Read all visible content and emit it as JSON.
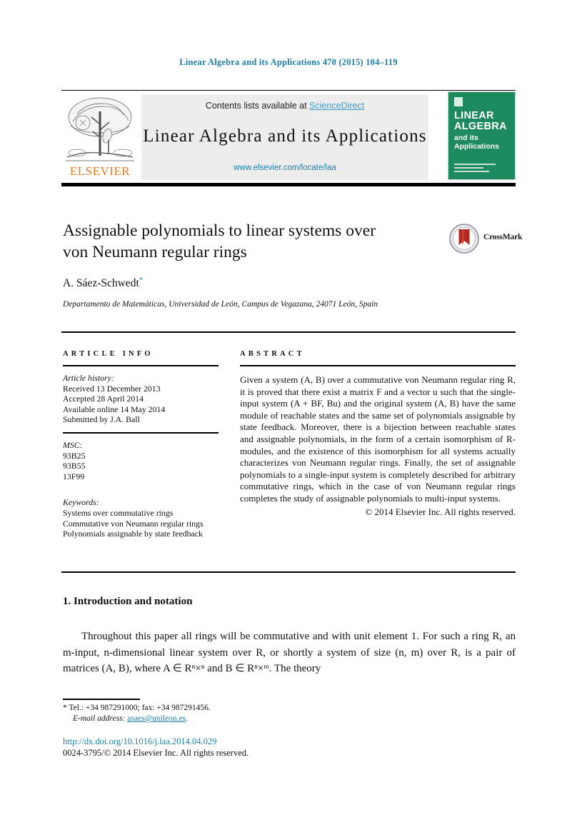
{
  "running_head": "Linear Algebra and its Applications 470 (2015) 104–119",
  "masthead": {
    "contents_prefix": "Contents lists available at ",
    "sciencedirect": "ScienceDirect",
    "journal_title": "Linear Algebra and its Applications",
    "journal_url": "www.elsevier.com/locate/laa",
    "publisher": "ELSEVIER",
    "cover": {
      "line1": "LINEAR",
      "line2": "ALGEBRA",
      "line3": "and its",
      "line4": "Applications"
    },
    "colors": {
      "link": "#1a7fa8",
      "sciencedirect": "#3c9cc8",
      "elsevier_orange": "#e87722",
      "cover_green": "#1e8a5f",
      "band_grey": "#ededed"
    }
  },
  "article": {
    "title_line1": "Assignable polynomials to linear systems over",
    "title_line2": "von Neumann regular rings",
    "author": "A. Sáez-Schwedt",
    "author_marker": "*",
    "affiliation": "Departamento de Matemáticas, Universidad de León, Campus de Vegazana, 24071 León, Spain",
    "crossmark_label": "CrossMark"
  },
  "info": {
    "heading": "ARTICLE INFO",
    "history_label": "Article history:",
    "history": [
      "Received 13 December 2013",
      "Accepted 28 April 2014",
      "Available online 14 May 2014",
      "Submitted by J.A. Ball"
    ],
    "msc_label": "MSC:",
    "msc": [
      "93B25",
      "93B55",
      "13F99"
    ],
    "keywords_label": "Keywords:",
    "keywords": [
      "Systems over commutative rings",
      "Commutative von Neumann regular rings",
      "Polynomials assignable by state feedback"
    ]
  },
  "abstract": {
    "heading": "ABSTRACT",
    "text": "Given a system (A, B) over a commutative von Neumann regular ring R, it is proved that there exist a matrix F and a vector u such that the single-input system (A + BF, Bu) and the original system (A, B) have the same module of reachable states and the same set of polynomials assignable by state feedback. Moreover, there is a bijection between reachable states and assignable polynomials, in the form of a certain isomorphism of R-modules, and the existence of this isomorphism for all systems actually characterizes von Neumann regular rings. Finally, the set of assignable polynomials to a single-input system is completely described for arbitrary commutative rings, which in the case of von Neumann regular rings completes the study of assignable polynomials to multi-input systems.",
    "copyright": "© 2014 Elsevier Inc. All rights reserved."
  },
  "section": {
    "number_title": "1. Introduction and notation",
    "paragraph": "Throughout this paper all rings will be commutative and with unit element 1. For such a ring R, an m-input, n-dimensional linear system over R, or shortly a system of size (n, m) over R, is a pair of matrices (A, B), where A ∈ Rⁿ×ⁿ and B ∈ Rⁿ×ᵐ. The theory"
  },
  "footer": {
    "tel_line": "* Tel.: +34 987291000; fax: +34 987291456.",
    "email_label": "E-mail address:",
    "email": "asaes@unileon.es",
    "email_suffix": ".",
    "doi": "http://dx.doi.org/10.1016/j.laa.2014.04.029",
    "issn_copyright": "0024-3795/© 2014 Elsevier Inc. All rights reserved."
  }
}
